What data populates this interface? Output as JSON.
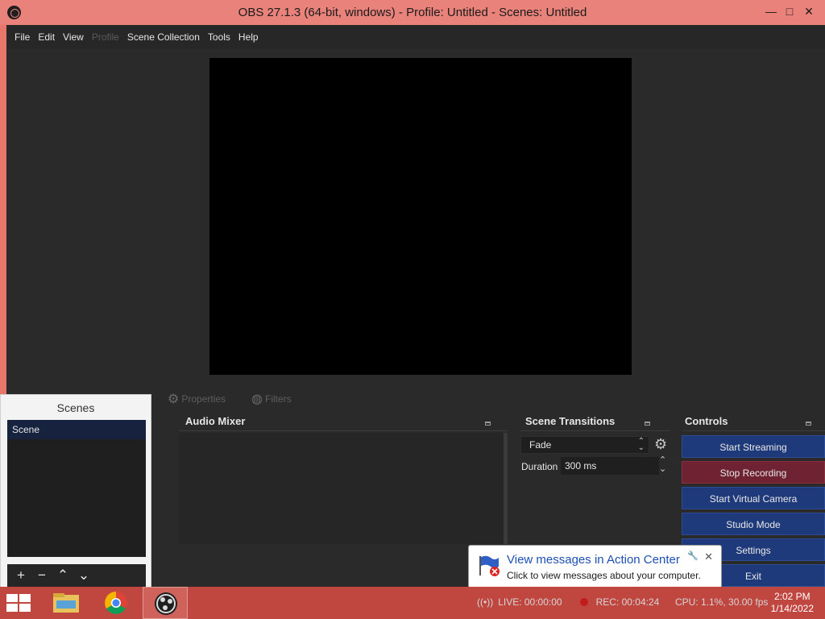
{
  "titlebar": {
    "title": "OBS 27.1.3 (64-bit, windows) - Profile: Untitled - Scenes: Untitled",
    "minimize": "—",
    "maximize": "□",
    "close": "✕"
  },
  "menu": [
    {
      "label": "File",
      "enabled": true
    },
    {
      "label": "Edit",
      "enabled": true
    },
    {
      "label": "View",
      "enabled": true
    },
    {
      "label": "Profile",
      "enabled": false
    },
    {
      "label": "Scene Collection",
      "enabled": true
    },
    {
      "label": "Tools",
      "enabled": true
    },
    {
      "label": "Help",
      "enabled": true
    }
  ],
  "source_toolbar": {
    "properties": "Properties",
    "filters": "Filters"
  },
  "docks": {
    "audio_mixer": "Audio Mixer",
    "scene_transitions": "Scene Transitions",
    "controls": "Controls"
  },
  "transitions": {
    "selected": "Fade",
    "duration_label": "Duration",
    "duration_value": "300 ms"
  },
  "controls": {
    "start_streaming": "Start Streaming",
    "stop_recording": "Stop Recording",
    "start_virtual_camera": "Start Virtual Camera",
    "studio_mode": "Studio Mode",
    "settings": "Settings",
    "exit": "Exit"
  },
  "scenes": {
    "title": "Scenes",
    "items": [
      "Scene"
    ]
  },
  "notification": {
    "title": "View messages in Action Center",
    "body": "Click to view messages about your computer."
  },
  "status": {
    "live": "LIVE: 00:00:00",
    "rec": "REC: 00:04:24",
    "cpu": "CPU: 1.1%, 30.00 fps"
  },
  "clock": {
    "time": "2:02 PM",
    "date": "1/14/2022"
  },
  "colors": {
    "titlebar": "#e9827a",
    "taskbar": "#c04640",
    "stream_button": "#1f3a7a",
    "stop_recording_button": "#6e2232"
  }
}
